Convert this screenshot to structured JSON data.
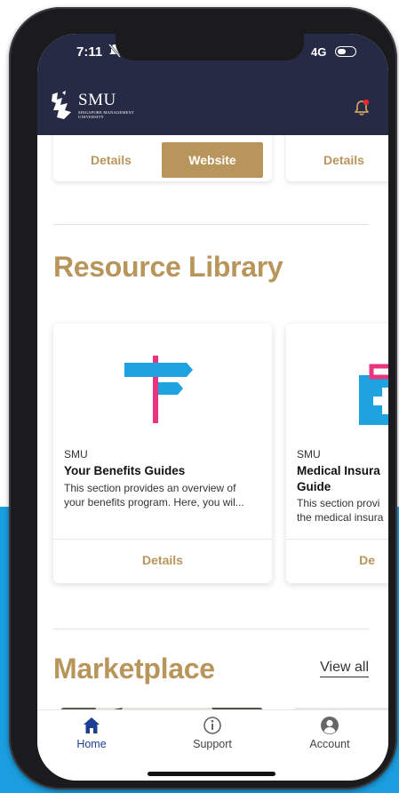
{
  "status": {
    "time": "7:11",
    "network": "4G"
  },
  "header": {
    "logo_text": "SMU",
    "logo_sub": "SINGAPORE MANAGEMENT UNIVERSITY",
    "notification_icon": "bell-icon",
    "notification_dot_color": "#e8262d"
  },
  "top_cards": {
    "left": {
      "details_label": "Details",
      "website_label": "Website"
    },
    "right": {
      "details_label": "Details"
    }
  },
  "resource_library": {
    "title": "Resource Library",
    "cards": [
      {
        "org": "SMU",
        "title": "Your Benefits Guides",
        "desc_line1": "This section provides an overview of",
        "desc_line2": "your benefits program. Here, you wil...",
        "details_label": "Details"
      },
      {
        "org": "SMU",
        "title_line1": "Medical Insura",
        "title_line2": "Guide",
        "desc_line1": "This section provi",
        "desc_line2": "the medical insura",
        "details_label": "De"
      }
    ]
  },
  "marketplace": {
    "title": "Marketplace",
    "view_all_label": "View all"
  },
  "bottom_nav": [
    {
      "label": "Home",
      "icon": "home-icon",
      "active": true
    },
    {
      "label": "Support",
      "icon": "info-icon",
      "active": false
    },
    {
      "label": "Account",
      "icon": "account-icon",
      "active": false
    }
  ],
  "colors": {
    "accent": "#b8955a",
    "header_bg": "#262a45",
    "nav_active": "#1c3f94"
  }
}
